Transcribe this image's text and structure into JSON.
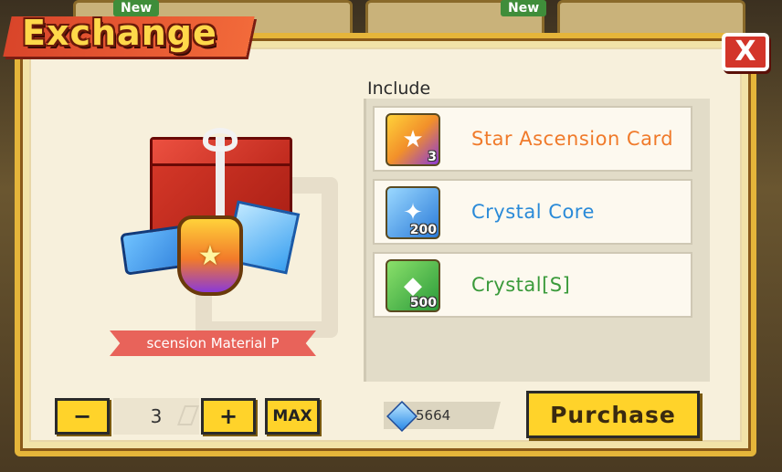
{
  "background": {
    "new_tags": [
      "New",
      "New"
    ]
  },
  "dialog": {
    "title": "Exchange",
    "close_label": "X"
  },
  "package": {
    "name": "scension Material P"
  },
  "include": {
    "label": "Include",
    "items": [
      {
        "name": "Star Ascension Card",
        "qty": "3",
        "icon": "star-ascension-card-icon",
        "color": "#f07a2a",
        "glyph": "★"
      },
      {
        "name": "Crystal Core",
        "qty": "200",
        "icon": "crystal-core-icon",
        "color": "#2a8ad8",
        "glyph": "✦"
      },
      {
        "name": "Crystal[S]",
        "qty": "500",
        "icon": "crystal-s-icon",
        "color": "#3a9a3a",
        "glyph": "◆"
      }
    ]
  },
  "quantity": {
    "minus_label": "−",
    "value": "3",
    "plus_label": "+",
    "max_label": "MAX"
  },
  "currency": {
    "icon": "crystal-currency-icon",
    "amount": "5664"
  },
  "purchase_label": "Purchase"
}
